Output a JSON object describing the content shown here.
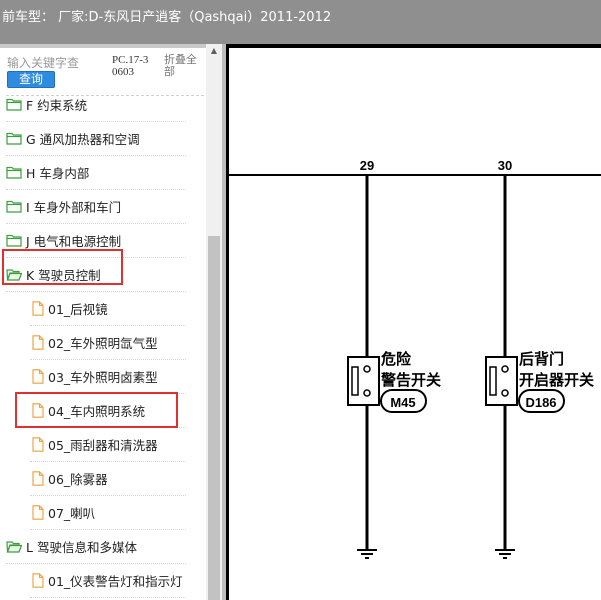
{
  "window": {
    "title": "前车型：  厂家:D-东风日产逍客（Qashqai）2011-2012"
  },
  "sidebar": {
    "search": {
      "placeholder": "输入关键字查",
      "button_label": "查询"
    },
    "doc_code": "PC.17-30603",
    "collapse_all_label": "折叠全部",
    "tree": [
      {
        "type": "folder",
        "label": "F 约束系统",
        "highlighted": false
      },
      {
        "type": "folder",
        "label": "G 通风加热器和空调",
        "highlighted": false
      },
      {
        "type": "folder",
        "label": "H 车身内部",
        "highlighted": false
      },
      {
        "type": "folder",
        "label": "I 车身外部和车门",
        "highlighted": false
      },
      {
        "type": "folder",
        "label": "J 电气和电源控制",
        "highlighted": false
      },
      {
        "type": "folder",
        "label": "K 驾驶员控制",
        "highlighted": true,
        "expanded": true
      },
      {
        "type": "file",
        "label": "01_后视镜",
        "highlighted": false
      },
      {
        "type": "file",
        "label": "02_车外照明氙气型",
        "highlighted": false
      },
      {
        "type": "file",
        "label": "03_车外照明卤素型",
        "highlighted": false
      },
      {
        "type": "file",
        "label": "04_车内照明系统",
        "highlighted": true
      },
      {
        "type": "file",
        "label": "05_雨刮器和清洗器",
        "highlighted": false
      },
      {
        "type": "file",
        "label": "06_除雾器",
        "highlighted": false
      },
      {
        "type": "file",
        "label": "07_喇叭",
        "highlighted": false
      },
      {
        "type": "folder",
        "label": "L 驾驶信息和多媒体",
        "highlighted": false,
        "expanded": true
      },
      {
        "type": "file",
        "label": "01_仪表警告灯和指示灯",
        "highlighted": false
      }
    ]
  },
  "diagram": {
    "circuits": [
      {
        "number": "29",
        "name_line1": "危险",
        "name_line2": "警告开关",
        "connector": "M45"
      },
      {
        "number": "30",
        "name_line1": "后背门",
        "name_line2": "开启器开关",
        "connector": "D186"
      }
    ]
  },
  "colors": {
    "titlebar": "#8f8f8f",
    "highlight": "#e03030",
    "search_button": "#2f8be0",
    "folder_icon": "#3e9e3e",
    "file_icon": "#e8a040"
  }
}
